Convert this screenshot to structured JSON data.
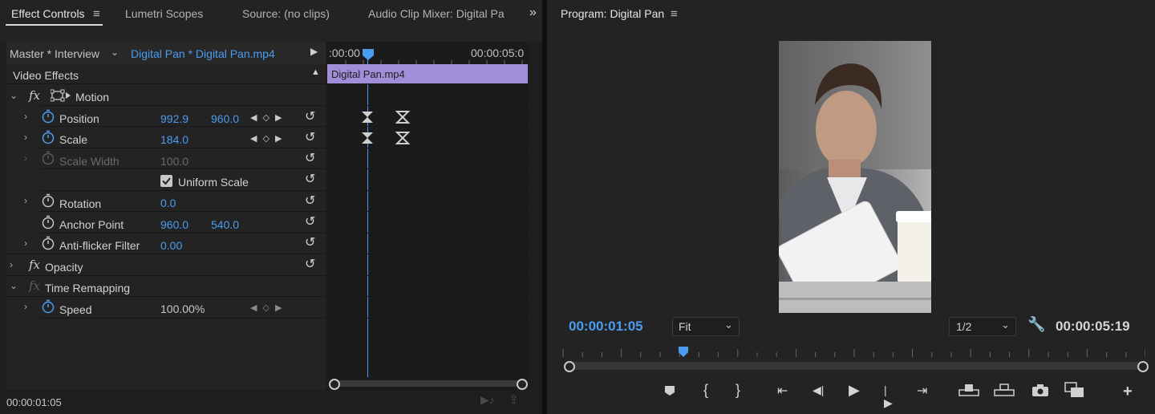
{
  "left_panel": {
    "tabs": [
      {
        "label": "Effect Controls",
        "active": true
      },
      {
        "label": "Lumetri Scopes"
      },
      {
        "label": "Source: (no clips)"
      },
      {
        "label": "Audio Clip Mixer: Digital Pa"
      }
    ],
    "source_label": "Master * Interview",
    "clip_label": "Digital Pan * Digital Pan.mp4",
    "timeline": {
      "start_time": ":00:00",
      "end_time": "00:00:05:0",
      "clip_name": "Digital Pan.mp4"
    },
    "section_label": "Video Effects",
    "effects": {
      "motion": {
        "fx": "fx",
        "name": "Motion",
        "properties": {
          "position": {
            "label": "Position",
            "x": "992.9",
            "y": "960.0"
          },
          "scale": {
            "label": "Scale",
            "value": "184.0"
          },
          "scale_width": {
            "label": "Scale Width",
            "value": "100.0"
          },
          "uniform_scale": {
            "label": "Uniform Scale",
            "checked": true
          },
          "rotation": {
            "label": "Rotation",
            "value": "0.0"
          },
          "anchor_point": {
            "label": "Anchor Point",
            "x": "960.0",
            "y": "540.0"
          },
          "anti_flicker": {
            "label": "Anti-flicker Filter",
            "value": "0.00"
          }
        }
      },
      "opacity": {
        "fx": "fx",
        "name": "Opacity"
      },
      "time_remapping": {
        "fx": "fx",
        "name": "Time Remapping",
        "speed": {
          "label": "Speed",
          "value": "100.00%"
        }
      }
    },
    "current_time": "00:00:01:05"
  },
  "program_monitor": {
    "title": "Program: Digital Pan",
    "current_time": "00:00:01:05",
    "zoom": "Fit",
    "resolution": "1/2",
    "duration": "00:00:05:19"
  },
  "colors": {
    "accent_blue": "#4b9cf0",
    "clip_purple": "#a08fd8",
    "panel_bg": "#232323"
  }
}
